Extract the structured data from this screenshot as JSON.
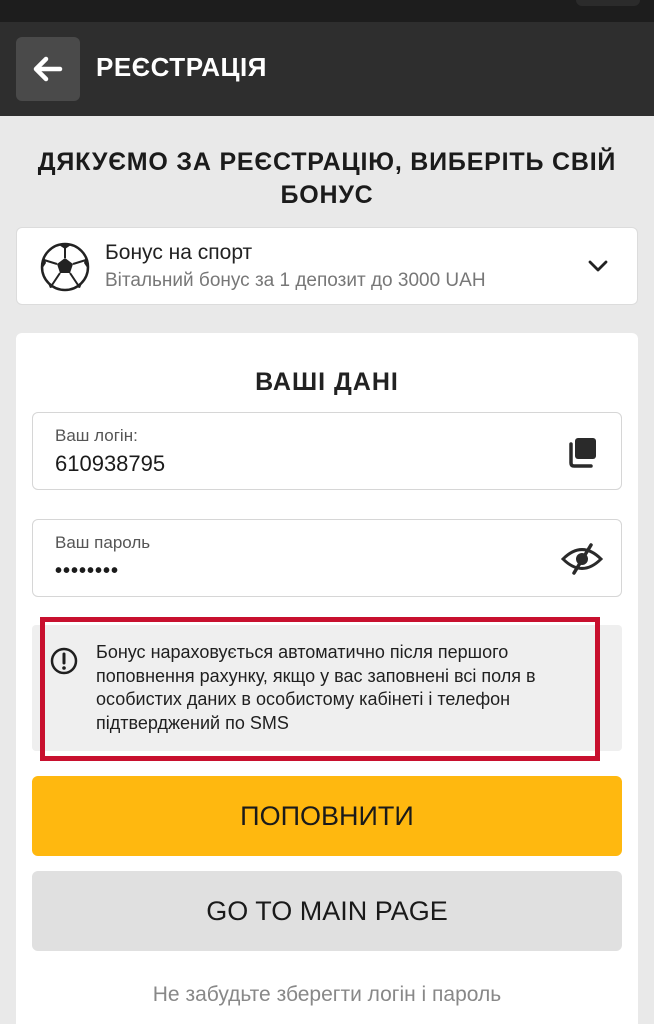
{
  "header": {
    "title": "РЕЄСТРАЦІЯ",
    "back_icon": "arrow-left-icon"
  },
  "thanks_heading": "ДЯКУЄМО ЗА РЕЄСТРАЦІЮ, ВИБЕРІТЬ СВІЙ БОНУС",
  "bonus": {
    "icon": "soccer-ball-icon",
    "title": "Бонус на спорт",
    "subtitle": "Вітальний бонус за 1 депозит до 3000 UAH",
    "chevron_icon": "chevron-down-icon"
  },
  "user_data": {
    "title": "ВАШІ ДАНІ",
    "login_label": "Ваш логін:",
    "login_value": "610938795",
    "copy_icon": "copy-icon",
    "password_label": "Ваш пароль",
    "password_value": "••••••••",
    "visibility_icon": "eye-slash-icon"
  },
  "notice": {
    "icon": "info-circle-icon",
    "text": "Бонус нараховується автоматично після першого поповнення рахунку, якщо у вас заповнені всі поля в особистих даних в особистому кабінеті і телефон підтверджений по SMS"
  },
  "buttons": {
    "topup": "ПОПОВНИТИ",
    "main_page": "GO TO MAIN PAGE"
  },
  "reminder": "Не забудьте зберегти логін і пароль",
  "colors": {
    "header_bg": "#2e2e2e",
    "accent_yellow": "#ffb80f",
    "highlight_red": "#c8102e",
    "page_bg": "#e9e9e9"
  }
}
